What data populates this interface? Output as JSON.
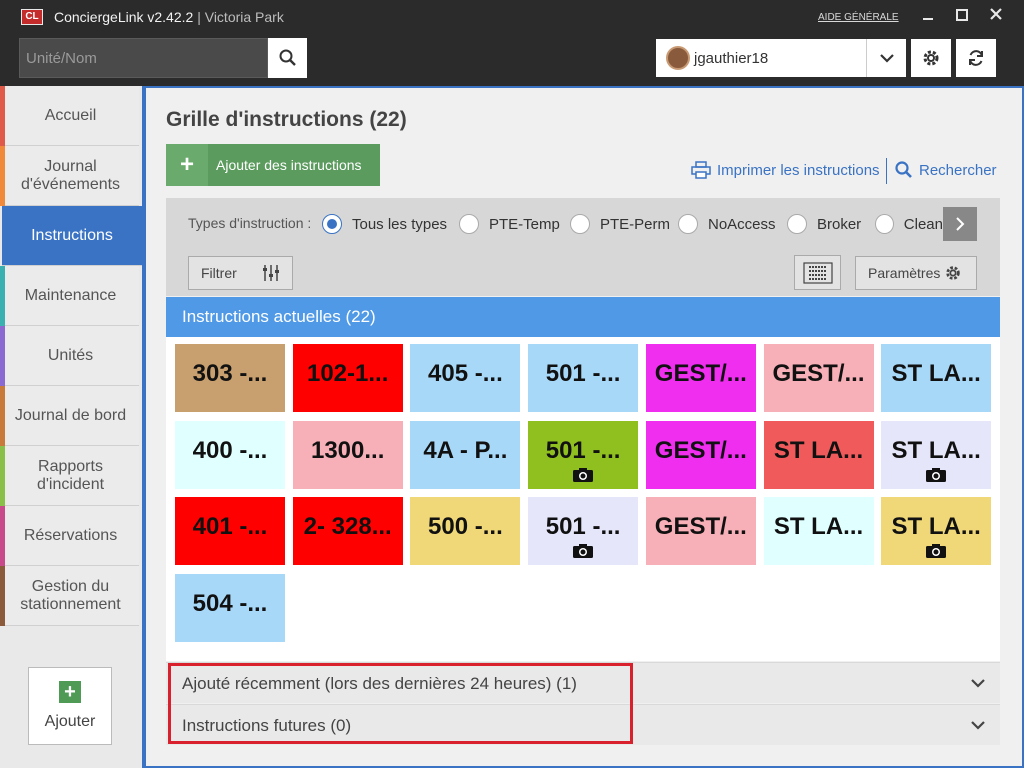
{
  "window": {
    "logo": "CL",
    "app_name": "ConciergeLink v2.42.2",
    "separator": "|",
    "site": "Victoria Park",
    "help": "AIDE GÉNÉRALE"
  },
  "toolbar": {
    "search_placeholder": "Unité/Nom",
    "user": "jgauthier18"
  },
  "sidebar": {
    "items": [
      {
        "label": "Accueil",
        "color": "#e05a4a"
      },
      {
        "label": "Journal d'événements",
        "color": "#f08a3a"
      },
      {
        "label": "Instructions",
        "color": "#3a73c4",
        "active": true
      },
      {
        "label": "Maintenance",
        "color": "#3ab0b0"
      },
      {
        "label": "Unités",
        "color": "#8a6ad0"
      },
      {
        "label": "Journal de bord",
        "color": "#c87a3a"
      },
      {
        "label": "Rapports d'incident",
        "color": "#8ac04a"
      },
      {
        "label": "Réservations",
        "color": "#c84a8a"
      },
      {
        "label": "Gestion du stationnement",
        "color": "#8a5a3a"
      }
    ],
    "add_label": "Ajouter"
  },
  "main": {
    "title": "Grille d'instructions (22)",
    "add_instructions": "Ajouter des instructions",
    "print": "Imprimer les instructions",
    "search": "Rechercher",
    "types_label": "Types d'instruction :",
    "types": [
      "Tous les types",
      "PTE-Temp",
      "PTE-Perm",
      "NoAccess",
      "Broker",
      "Clean"
    ],
    "selected_type": "Tous les types",
    "filter": "Filtrer",
    "params": "Paramètres",
    "current_header": "Instructions actuelles (22)",
    "tiles": [
      {
        "text": "303 -...",
        "color": "#c8a070",
        "camera": false
      },
      {
        "text": "102-1...",
        "color": "#ff0000",
        "camera": false
      },
      {
        "text": "405 -...",
        "color": "#a8d8f8",
        "camera": false
      },
      {
        "text": "501 -...",
        "color": "#a8d8f8",
        "camera": false
      },
      {
        "text": "GEST/...",
        "color": "#f02ef0",
        "camera": false
      },
      {
        "text": "GEST/...",
        "color": "#f8b0b8",
        "camera": false
      },
      {
        "text": "ST LA...",
        "color": "#a8d8f8",
        "camera": false
      },
      {
        "text": "400 -...",
        "color": "#e0ffff",
        "camera": false
      },
      {
        "text": "1300...",
        "color": "#f8b0b8",
        "camera": false
      },
      {
        "text": "4A - P...",
        "color": "#a8d8f8",
        "camera": false
      },
      {
        "text": "501 -...",
        "color": "#90c020",
        "camera": true
      },
      {
        "text": "GEST/...",
        "color": "#f02ef0",
        "camera": false
      },
      {
        "text": "ST LA...",
        "color": "#f05a5a",
        "camera": false
      },
      {
        "text": "ST LA...",
        "color": "#e6e6fa",
        "camera": true
      },
      {
        "text": "401 -...",
        "color": "#ff0000",
        "camera": false
      },
      {
        "text": "2- 328...",
        "color": "#ff0000",
        "camera": false
      },
      {
        "text": "500 -...",
        "color": "#f0d878",
        "camera": false
      },
      {
        "text": "501 -...",
        "color": "#e6e6fa",
        "camera": true
      },
      {
        "text": "GEST/...",
        "color": "#f8b0b8",
        "camera": false
      },
      {
        "text": "ST LA...",
        "color": "#e0ffff",
        "camera": false
      },
      {
        "text": "ST LA...",
        "color": "#f0d878",
        "camera": true
      },
      {
        "text": "504 -...",
        "color": "#a8d8f8",
        "camera": false
      }
    ],
    "recent": "Ajouté récemment (lors des dernières 24 heures) (1)",
    "future": "Instructions futures (0)"
  }
}
